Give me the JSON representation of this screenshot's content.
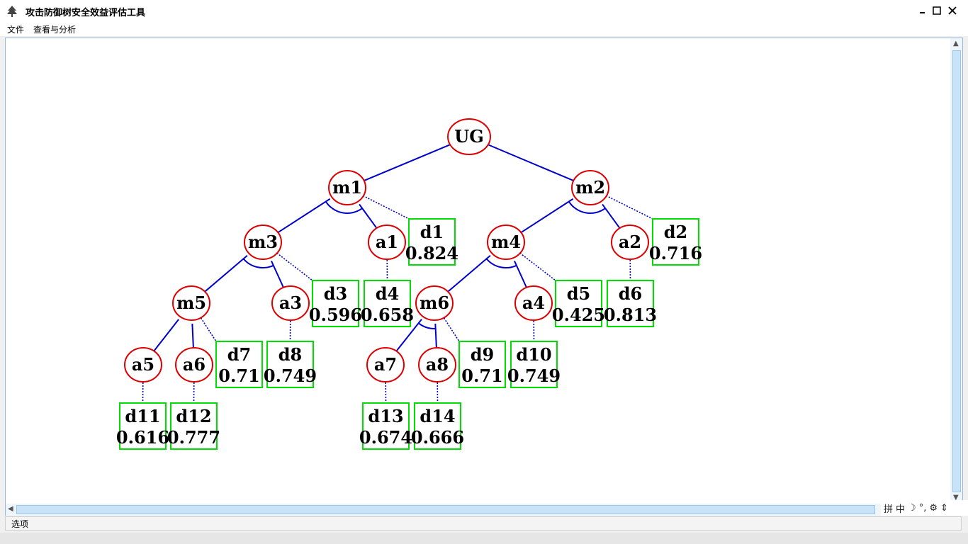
{
  "window": {
    "title": "攻击防御树安全效益评估工具"
  },
  "menu": {
    "items": [
      "文件",
      "查看与分析"
    ]
  },
  "status": {
    "label": "选项"
  },
  "ime": {
    "items": [
      "拼",
      "中",
      "☽",
      "°,",
      "⚙",
      "⇕"
    ]
  },
  "colors": {
    "edge": "#0000cc",
    "circle_stroke": "#dd0000",
    "box_stroke": "#00dd00"
  },
  "tree": {
    "nodes": [
      {
        "id": "UG",
        "label": "UG"
      },
      {
        "id": "m1",
        "label": "m1"
      },
      {
        "id": "m2",
        "label": "m2"
      },
      {
        "id": "m3",
        "label": "m3"
      },
      {
        "id": "a1",
        "label": "a1"
      },
      {
        "id": "m4",
        "label": "m4"
      },
      {
        "id": "a2",
        "label": "a2"
      },
      {
        "id": "m5",
        "label": "m5"
      },
      {
        "id": "a3",
        "label": "a3"
      },
      {
        "id": "m6",
        "label": "m6"
      },
      {
        "id": "a4",
        "label": "a4"
      },
      {
        "id": "a5",
        "label": "a5"
      },
      {
        "id": "a6",
        "label": "a6"
      },
      {
        "id": "a7",
        "label": "a7"
      },
      {
        "id": "a8",
        "label": "a8"
      }
    ],
    "defenses": [
      {
        "id": "d1",
        "label": "d1",
        "value": "0.824"
      },
      {
        "id": "d2",
        "label": "d2",
        "value": "0.716"
      },
      {
        "id": "d3",
        "label": "d3",
        "value": "0.596"
      },
      {
        "id": "d4",
        "label": "d4",
        "value": "0.658"
      },
      {
        "id": "d5",
        "label": "d5",
        "value": "0.425"
      },
      {
        "id": "d6",
        "label": "d6",
        "value": "0.813"
      },
      {
        "id": "d7",
        "label": "d7",
        "value": "0.71"
      },
      {
        "id": "d8",
        "label": "d8",
        "value": "0.749"
      },
      {
        "id": "d9",
        "label": "d9",
        "value": "0.71"
      },
      {
        "id": "d10",
        "label": "d10",
        "value": "0.749"
      },
      {
        "id": "d11",
        "label": "d11",
        "value": "0.616"
      },
      {
        "id": "d12",
        "label": "d12",
        "value": "0.777"
      },
      {
        "id": "d13",
        "label": "d13",
        "value": "0.674"
      },
      {
        "id": "d14",
        "label": "d14",
        "value": "0.666"
      }
    ]
  }
}
